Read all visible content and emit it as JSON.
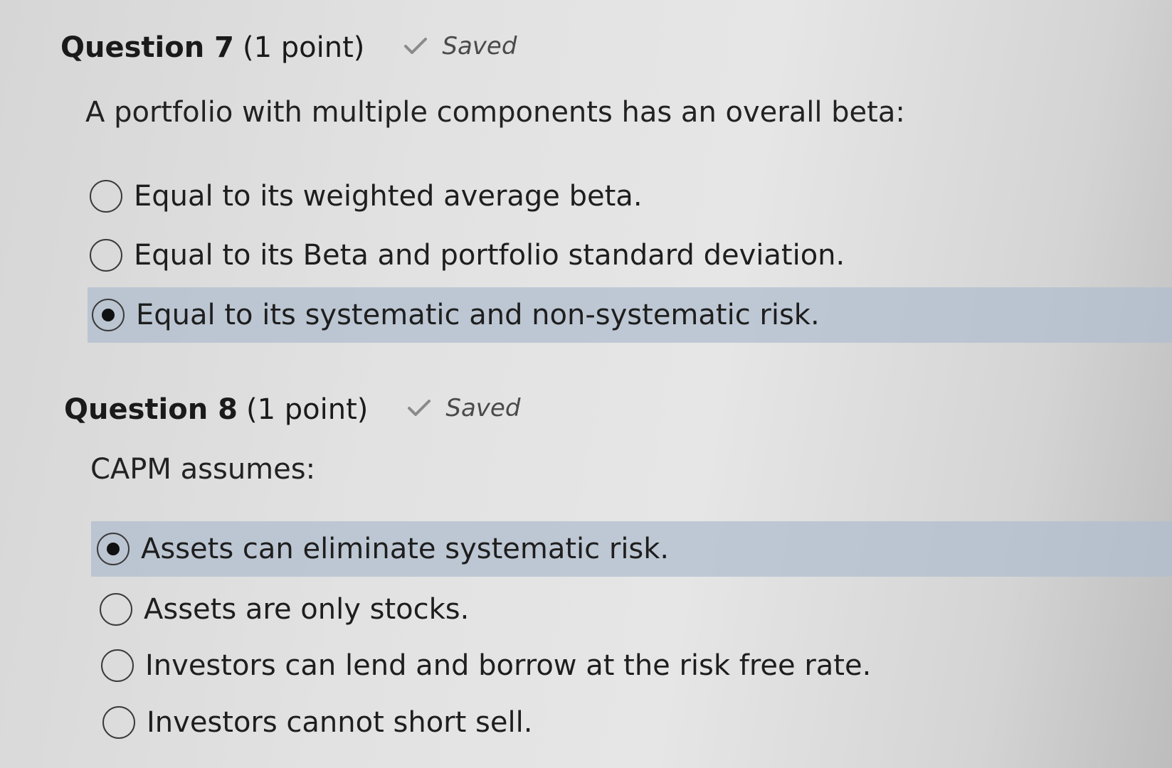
{
  "questions": [
    {
      "title": "Question 7",
      "points": "(1 point)",
      "status": "Saved",
      "prompt": "A portfolio with multiple components has an overall beta:",
      "options": [
        {
          "label": "Equal to its weighted average beta.",
          "selected": false
        },
        {
          "label": "Equal to its Beta and portfolio standard deviation.",
          "selected": false
        },
        {
          "label": "Equal to its systematic and non-systematic risk.",
          "selected": true
        }
      ]
    },
    {
      "title": "Question 8",
      "points": "(1 point)",
      "status": "Saved",
      "prompt": "CAPM assumes:",
      "options": [
        {
          "label": "Assets can eliminate systematic risk.",
          "selected": true
        },
        {
          "label": "Assets are only stocks.",
          "selected": false
        },
        {
          "label": "Investors can lend and borrow at the risk free rate.",
          "selected": false
        },
        {
          "label": "Investors cannot short sell.",
          "selected": false
        }
      ]
    }
  ],
  "colors": {
    "selected_row": "#b0becd",
    "saved_check": "#8a8a8a"
  }
}
